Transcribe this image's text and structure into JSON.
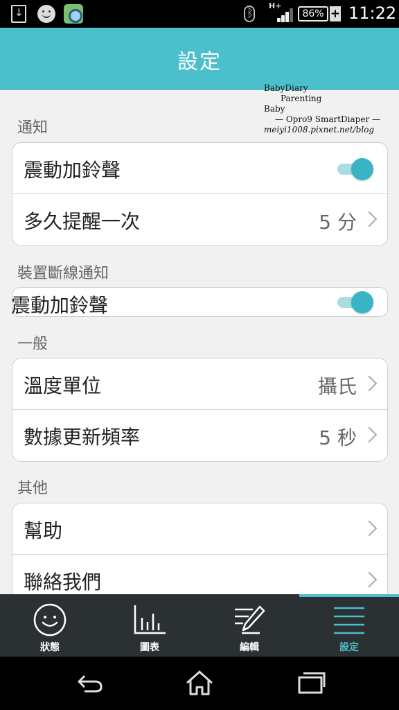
{
  "status_bar": {
    "network": "H+",
    "battery": "86%",
    "time": "11:22",
    "icons": [
      "download-icon",
      "smiley-icon",
      "camera-app-icon",
      "bluetooth-icon",
      "signal-icon",
      "battery-icon",
      "charging-icon"
    ]
  },
  "header": {
    "title": "設定"
  },
  "watermark": {
    "line1": "BabyDiary",
    "line2": "Parenting",
    "line3": "Baby",
    "line4": "— Opro9 SmartDiaper —",
    "line5": "meiyi1008.pixnet.net/blog"
  },
  "sections": {
    "notify": {
      "label": "通知",
      "vibrate_label": "震動加鈴聲",
      "vibrate_on": true,
      "remind_label": "多久提醒一次",
      "remind_value": "5 分"
    },
    "disconnect": {
      "label": "裝置斷線通知",
      "vibrate_label": "震動加鈴聲",
      "vibrate_on": true
    },
    "general": {
      "label": "一般",
      "temp_label": "溫度單位",
      "temp_value": "攝氏",
      "refresh_label": "數據更新頻率",
      "refresh_value": "5 秒"
    },
    "other": {
      "label": "其他",
      "help_label": "幫助",
      "contact_label": "聯絡我們"
    }
  },
  "tabs": [
    {
      "label": "狀態",
      "icon": "smiley-face-icon",
      "active": false
    },
    {
      "label": "圖表",
      "icon": "bar-chart-icon",
      "active": false
    },
    {
      "label": "編輯",
      "icon": "edit-pencil-icon",
      "active": false
    },
    {
      "label": "設定",
      "icon": "menu-lines-icon",
      "active": true
    }
  ],
  "colors": {
    "accent": "#4bbfcc",
    "tab_bar": "#2b3133",
    "toggle_on": "#39b4c4"
  }
}
